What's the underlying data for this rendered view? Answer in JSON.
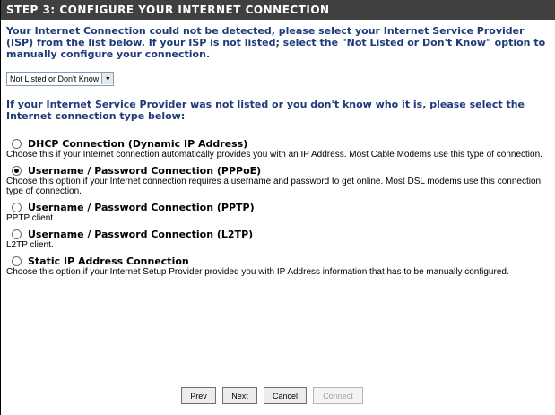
{
  "header": {
    "title": "STEP 3: CONFIGURE YOUR INTERNET CONNECTION"
  },
  "intro": "Your Internet Connection could not be detected, please select your Internet Service Provider (ISP) from the list below. If your ISP is not listed; select the \"Not Listed or Don't Know\" option to manually configure your connection.",
  "isp_select": {
    "value": "Not Listed or Don't Know"
  },
  "subhead": "If your Internet Service Provider was not listed or you don't know who it is, please select the Internet connection type below:",
  "options": [
    {
      "title": "DHCP Connection (Dynamic IP Address)",
      "desc": "Choose this if your Internet connection automatically provides you with an IP Address. Most Cable Modems use this type of connection.",
      "selected": false
    },
    {
      "title": "Username / Password Connection (PPPoE)",
      "desc": "Choose this option if your Internet connection requires a username and password to get online. Most DSL modems use this connection type of connection.",
      "selected": true
    },
    {
      "title": "Username / Password Connection (PPTP)",
      "desc": "PPTP client.",
      "selected": false
    },
    {
      "title": "Username / Password Connection (L2TP)",
      "desc": "L2TP client.",
      "selected": false
    },
    {
      "title": "Static IP Address Connection",
      "desc": "Choose this option if your Internet Setup Provider provided you with IP Address information that has to be manually configured.",
      "selected": false
    }
  ],
  "buttons": {
    "prev": "Prev",
    "next": "Next",
    "cancel": "Cancel",
    "connect": "Connect"
  }
}
